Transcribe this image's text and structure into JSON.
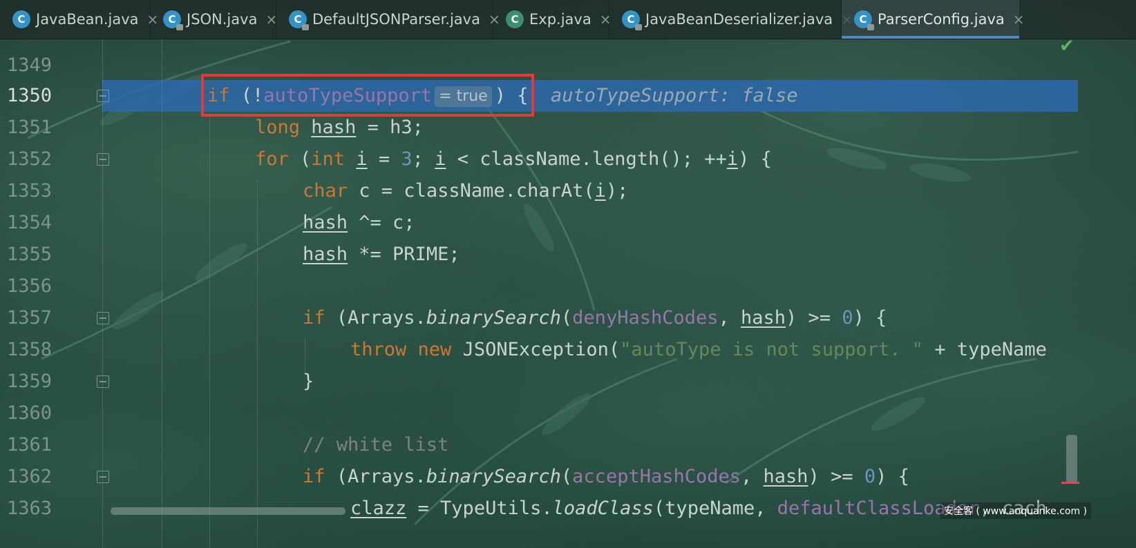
{
  "tabs": [
    {
      "label": "JavaBean.java",
      "icon": "class-icon",
      "close": "×"
    },
    {
      "label": "JSON.java",
      "icon": "class-locked-icon",
      "close": "×"
    },
    {
      "label": "DefaultJSONParser.java",
      "icon": "class-locked-icon",
      "close": "×"
    },
    {
      "label": "Exp.java",
      "icon": "runnable-class-icon",
      "close": "×"
    },
    {
      "label": "JavaBeanDeserializer.java",
      "icon": "class-locked-icon",
      "close": "×"
    },
    {
      "label": "ParserConfig.java",
      "icon": "class-locked-icon",
      "close": "×",
      "active": true
    }
  ],
  "editor": {
    "line_numbers": [
      "1349",
      "1350",
      "1351",
      "1352",
      "1353",
      "1354",
      "1355",
      "1356",
      "1357",
      "1358",
      "1359",
      "1360",
      "1361",
      "1362",
      "1363"
    ],
    "current_line": "1350",
    "lines": {
      "l1350": {
        "kw_if": "if",
        "open": " (!",
        "field": "autoTypeSupport",
        "hint": "= true",
        "close": ") {",
        "inline_value": "autoTypeSupport: false"
      },
      "l1351": {
        "kw": "long",
        "var": "hash",
        "rest": " = h3;"
      },
      "l1352": {
        "kw_for": "for",
        "p1": " (",
        "kw_int": "int",
        "sp": " ",
        "v1": "i",
        "p2": " = ",
        "n3": "3",
        "p3": "; ",
        "v2": "i",
        "p4": " < className.length(); ++",
        "v3": "i",
        "p5": ") {"
      },
      "l1353": {
        "kw": "char",
        "p1": " c = className.charAt(",
        "v": "i",
        "p2": ");"
      },
      "l1354": {
        "var": "hash",
        "rest": " ^= c;"
      },
      "l1355": {
        "var": "hash",
        "rest": " *= PRIME;"
      },
      "l1357": {
        "kw": "if",
        "p1": " (Arrays.",
        "method": "binarySearch",
        "p2": "(",
        "field": "denyHashCodes",
        "p3": ", ",
        "var": "hash",
        "p4": ") >= ",
        "num": "0",
        "p5": ") {"
      },
      "l1358": {
        "kw_throw": "throw",
        "kw_new": "new",
        "p1": " JSONException(",
        "str": "\"autoType is not support. \"",
        "p2": " + typeName"
      },
      "l1359": {
        "text": "}"
      },
      "l1361": {
        "comment": "// white list"
      },
      "l1362": {
        "kw": "if",
        "p1": " (Arrays.",
        "method": "binarySearch",
        "p2": "(",
        "field": "acceptHashCodes",
        "p3": ", ",
        "var": "hash",
        "p4": ") >= ",
        "num": "0",
        "p5": ") {"
      },
      "l1363": {
        "var": "clazz",
        "p1": " = TypeUtils.",
        "method": "loadClass",
        "p2": "(typeName, ",
        "field": "defaultClassLoader",
        "p3": ", cach"
      }
    }
  },
  "status": {
    "check": "✔"
  },
  "watermark": "安全客 ( www.anquanke.com )"
}
